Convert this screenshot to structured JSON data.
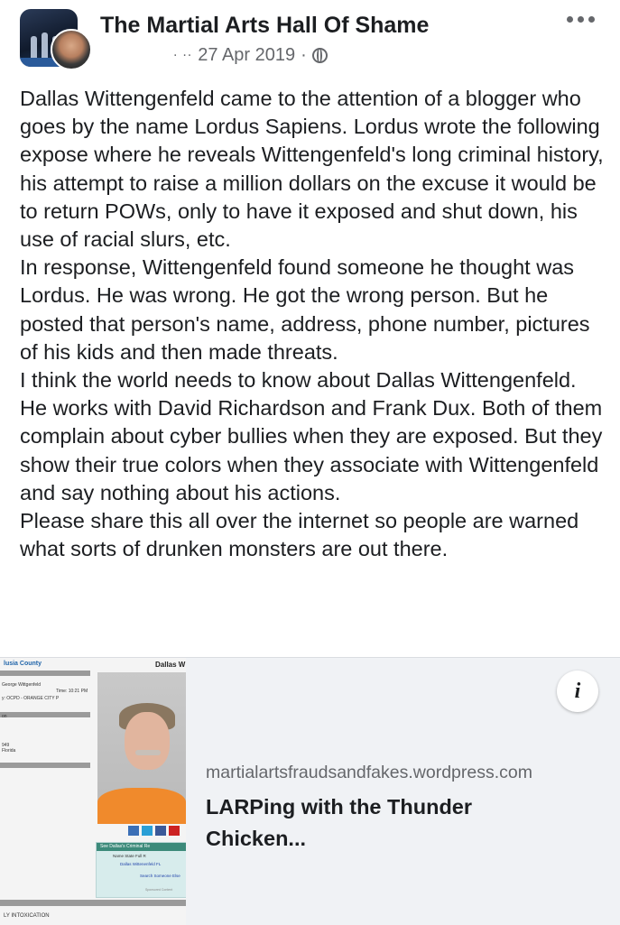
{
  "post": {
    "page_name": "The Martial Arts Hall Of Shame",
    "date": "27 Apr 2019",
    "date_separator": "·",
    "privacy_icon": "globe-icon",
    "more_icon": "more-options-icon",
    "paragraphs": [
      "Dallas Wittengenfeld came to the attention of a blogger who goes by the name Lordus Sapiens. Lordus wrote the following expose where he reveals Wittengenfeld's long criminal history, his attempt to raise a million dollars on the excuse it would be to return POWs, only to have it exposed and shut down, his use of racial slurs, etc.",
      "In response, Wittengenfeld found someone he thought was Lordus. He was wrong. He got the wrong person. But he posted that person's name, address, phone number, pictures of his kids and then made threats.",
      "I think the world needs to know about Dallas Wittengenfeld. He works with David Richardson and Frank Dux. Both of them complain about cyber bullies when they are exposed. But they show their true colors when they associate with Wittengenfeld and say nothing about his actions.",
      "Please share this all over the internet so people are warned what sorts of drunken monsters are out there."
    ]
  },
  "link_preview": {
    "domain": "martialartsfraudsandfakes.wordpress.com",
    "title": "LARPing with the Thunder Chicken...",
    "info_icon": "info-icon",
    "thumbnail": {
      "county": "lusia County",
      "name_header": "Dallas W",
      "lines": [
        "George Wittgenfeld",
        "Time: 10:21 PM",
        "y: OCPD - ORANGE CITY P",
        "on",
        "949",
        "Florida"
      ],
      "criminal_box_title": "See Dallas's Criminal Re",
      "criminal_box_cols": "Name      State    Full R",
      "criminal_box_row": "Dallas Wittenenfeld   FL",
      "criminal_box_link": "Search Someone Else",
      "criminal_box_footer": "Sponsored Content",
      "bottom_text": "LY INTOXICATION"
    }
  },
  "colors": {
    "text_primary": "#1c1e21",
    "text_secondary": "#65676b",
    "card_background": "#f0f2f5",
    "mugshot_shirt": "#f08a2c"
  }
}
